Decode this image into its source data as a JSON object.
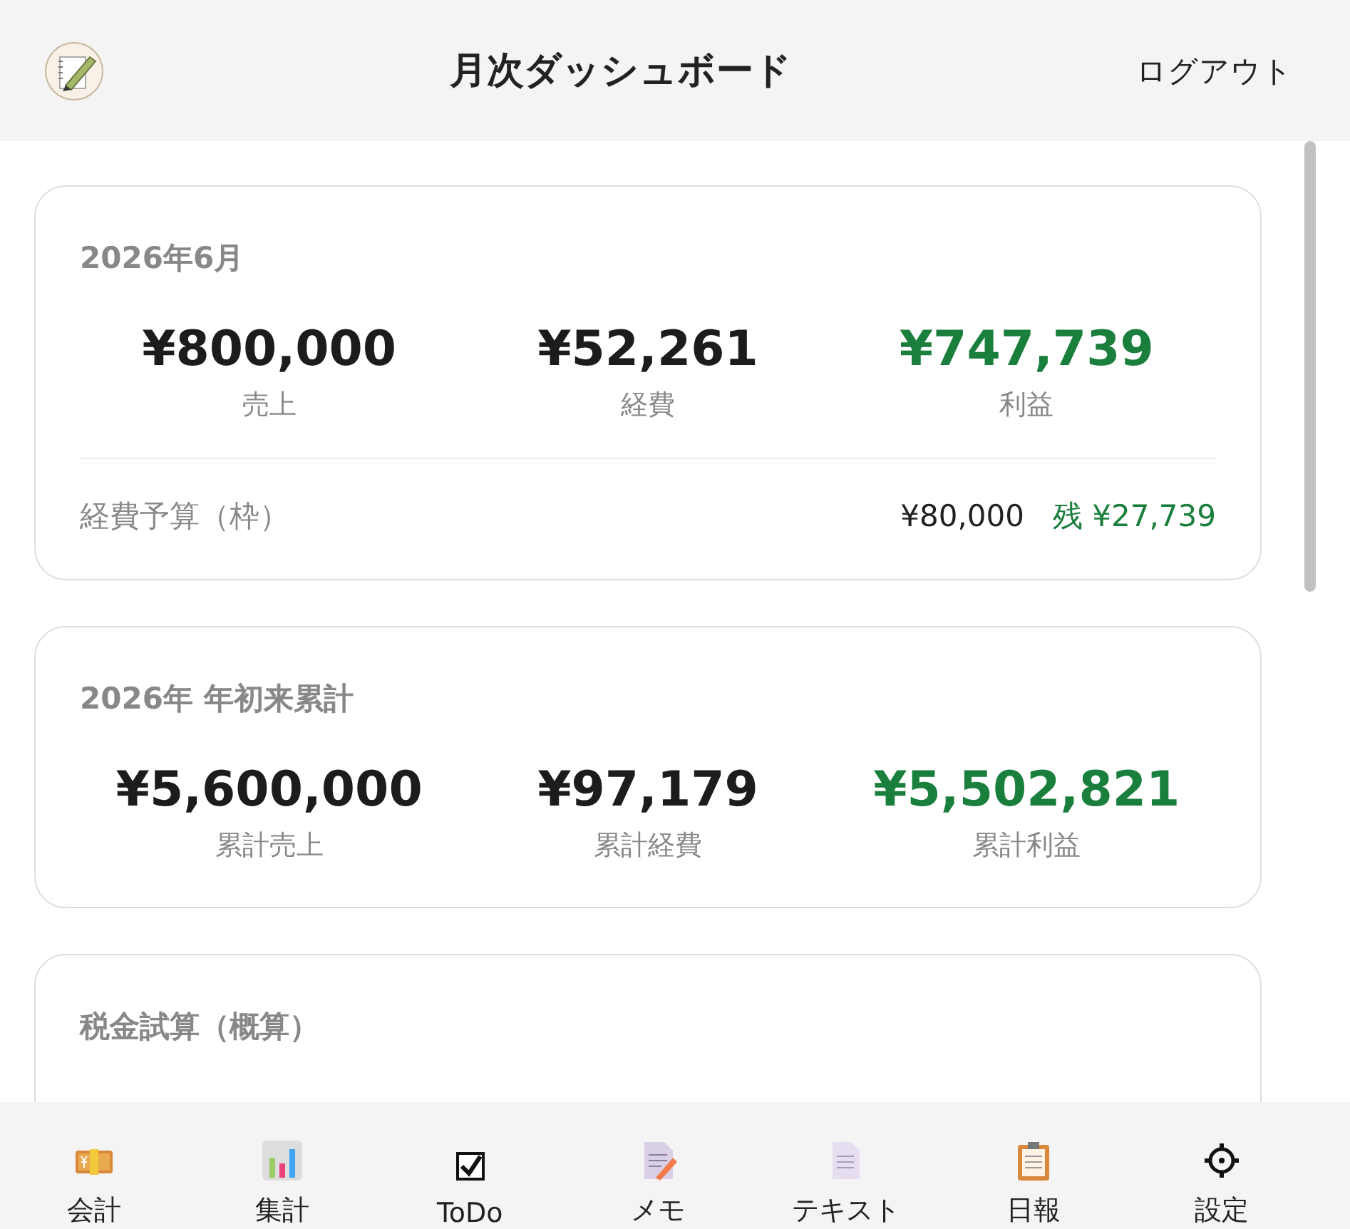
{
  "header": {
    "title": "月次ダッシュボード",
    "logout": "ログアウト"
  },
  "cards": [
    {
      "title": "2026年6月",
      "metrics": [
        {
          "value": "¥800,000",
          "label": "売上",
          "kind": "amount"
        },
        {
          "value": "¥52,261",
          "label": "経費",
          "kind": "amount"
        },
        {
          "value": "¥747,739",
          "label": "利益",
          "kind": "profit"
        }
      ],
      "budget": {
        "label": "経費予算（枠）",
        "amount": "¥80,000",
        "remaining": "残 ¥27,739"
      }
    },
    {
      "title": "2026年 年初来累計",
      "metrics": [
        {
          "value": "¥5,600,000",
          "label": "累計売上",
          "kind": "amount"
        },
        {
          "value": "¥97,179",
          "label": "累計経費",
          "kind": "amount"
        },
        {
          "value": "¥5,502,821",
          "label": "累計利益",
          "kind": "profit"
        }
      ]
    },
    {
      "title": "税金試算（概算）"
    }
  ],
  "nav": [
    {
      "label": "会計"
    },
    {
      "label": "集計"
    },
    {
      "label": "ToDo"
    },
    {
      "label": "メモ"
    },
    {
      "label": "テキスト"
    },
    {
      "label": "日報"
    },
    {
      "label": "設定"
    }
  ]
}
